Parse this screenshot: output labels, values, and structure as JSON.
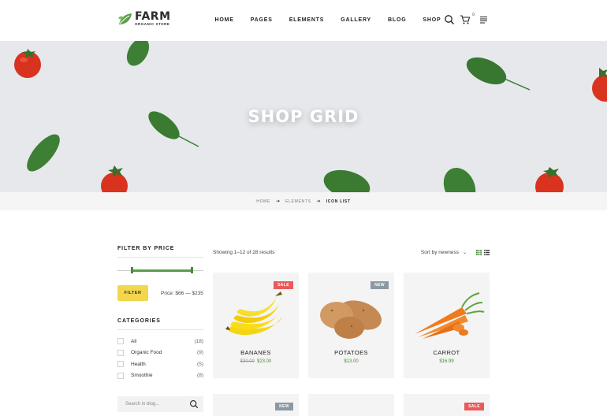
{
  "brand": {
    "name": "FARM",
    "tagline": "ORGANIC STORE"
  },
  "nav": [
    "HOME",
    "PAGES",
    "ELEMENTS",
    "GALLERY",
    "BLOG",
    "SHOP"
  ],
  "header": {
    "cart_count": "0"
  },
  "hero": {
    "title": "SHOP GRID"
  },
  "breadcrumb": {
    "items": [
      "HOME",
      "ELEMENTS",
      "ICON LIST"
    ]
  },
  "sidebar": {
    "filter_title": "FILTER BY PRICE",
    "price_range": {
      "min_fraction": 0.17,
      "max_fraction": 0.87
    },
    "filter_button": "FILTER",
    "price_label": "Price: $66 — $235",
    "categories_title": "CATEGORIES",
    "categories": [
      {
        "name": "All",
        "count": "(18)"
      },
      {
        "name": "Organic Food",
        "count": "(9)"
      },
      {
        "name": "Health",
        "count": "(5)"
      },
      {
        "name": "Smoothie",
        "count": "(8)"
      }
    ],
    "search_placeholder": "Search in blog..."
  },
  "toolbar": {
    "results": "Showing 1–12 of 28 results",
    "sort": "Sort by newness"
  },
  "products": [
    {
      "name": "BANANES",
      "old_price": "$30.00",
      "price": "$23.00",
      "badge": "SALE"
    },
    {
      "name": "POTATOES",
      "old_price": "",
      "price": "$13.00",
      "badge": "NEW"
    },
    {
      "name": "CARROT",
      "old_price": "",
      "price": "$16.99",
      "badge": ""
    }
  ],
  "products_row2_badges": [
    "NEW",
    "",
    "SALE"
  ],
  "colors": {
    "accent_green": "#4a8a3c",
    "filter_yellow": "#f2d64b",
    "sale_red": "#e95a5a",
    "new_gray": "#8a9aa2"
  }
}
